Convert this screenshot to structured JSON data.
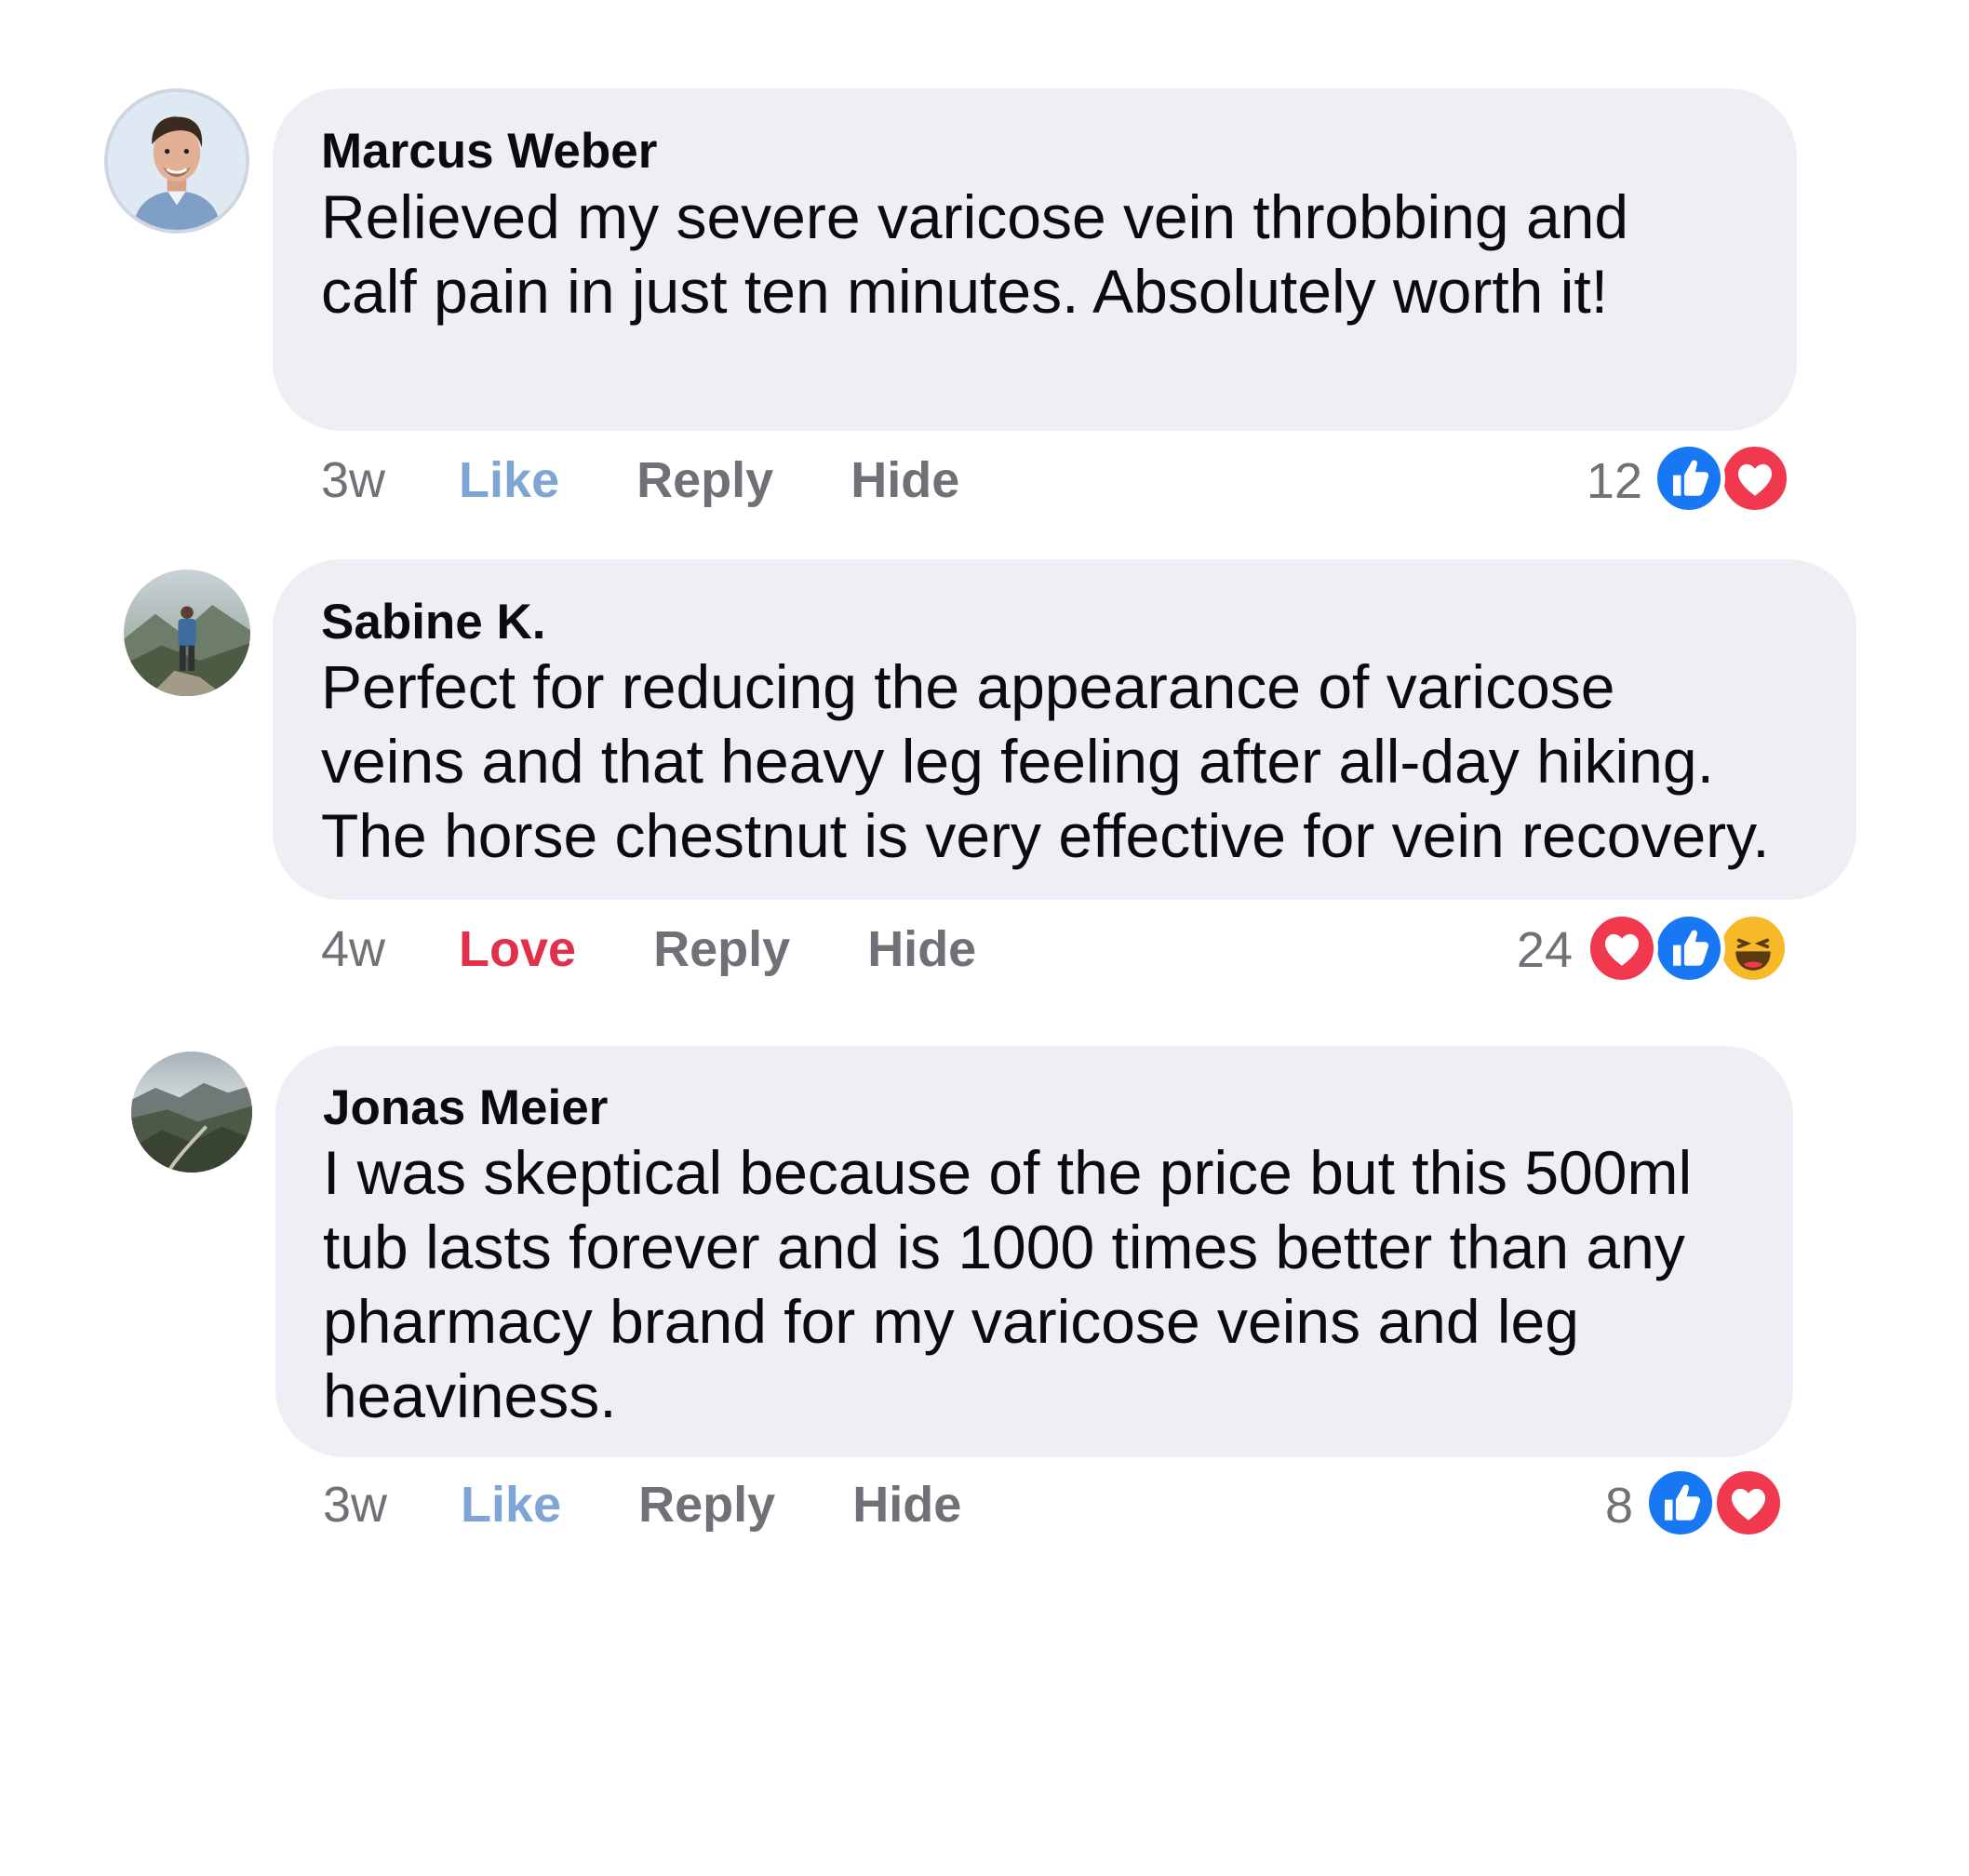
{
  "comments": [
    {
      "author": "Marcus Weber",
      "lines": [
        "Relieved my severe varicose vein throbbing and",
        "calf pain in just ten minutes. Absolutely worth it!"
      ],
      "time": "3w",
      "reaction_action": "Like",
      "reply_label": "Reply",
      "hide_label": "Hide",
      "reaction_count": "12",
      "reactions": [
        "like-icon",
        "love-icon"
      ],
      "avatar": "man-portrait-avatar"
    },
    {
      "author": "Sabine K.",
      "lines": [
        "Perfect for reducing the appearance of varicose",
        "veins and that heavy leg feeling after all-day hiking.",
        "The horse chestnut is very effective for vein recovery."
      ],
      "time": "4w",
      "reaction_action": "Love",
      "reply_label": "Reply",
      "hide_label": "Hide",
      "reaction_count": "24",
      "reactions": [
        "love-icon",
        "like-icon",
        "haha-icon"
      ],
      "avatar": "hiker-mountain-avatar"
    },
    {
      "author": "Jonas Meier",
      "lines": [
        "I was skeptical because of the price but this 500ml",
        "tub lasts forever and is 1000 times better than any",
        "pharmacy brand for my varicose veins and leg",
        "heaviness."
      ],
      "time": "3w",
      "reaction_action": "Like",
      "reply_label": "Reply",
      "hide_label": "Hide",
      "reaction_count": "8",
      "reactions": [
        "like-icon",
        "love-icon"
      ],
      "avatar": "mountain-valley-avatar"
    }
  ],
  "colors": {
    "bubble": "#eeeef4",
    "like_active": "#7ea5d4",
    "love_active": "#e0304a",
    "meta_gray": "#6f7176",
    "like_blue": "#1877f2",
    "love_red": "#f0384f",
    "haha_yellow": "#f7b928"
  }
}
